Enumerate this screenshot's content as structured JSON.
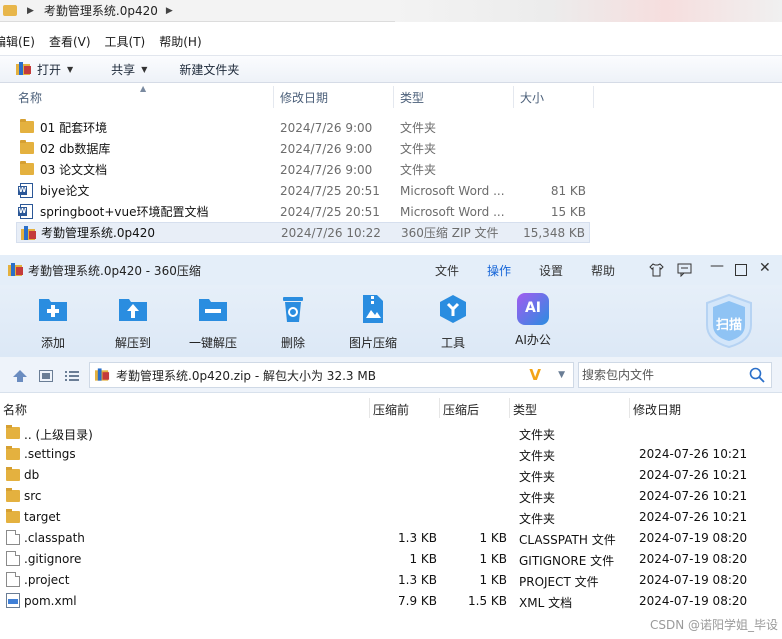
{
  "explorer": {
    "address_path": "考勤管理系统.0p420",
    "menu": [
      "编辑(E)",
      "查看(V)",
      "工具(T)",
      "帮助(H)"
    ],
    "toolbar": {
      "open": "打开",
      "share": "共享",
      "new_folder": "新建文件夹"
    },
    "columns": [
      "名称",
      "修改日期",
      "类型",
      "大小"
    ],
    "files": [
      {
        "name": "01 配套环境",
        "date": "2024/7/26 9:00",
        "type": "文件夹",
        "size": "",
        "icon": "folder-icon"
      },
      {
        "name": "02 db数据库",
        "date": "2024/7/26 9:00",
        "type": "文件夹",
        "size": "",
        "icon": "folder-icon"
      },
      {
        "name": "03 论文文档",
        "date": "2024/7/26 9:00",
        "type": "文件夹",
        "size": "",
        "icon": "folder-icon"
      },
      {
        "name": "biye论文",
        "date": "2024/7/25 20:51",
        "type": "Microsoft Word ...",
        "size": "81 KB",
        "icon": "word-doc-icon"
      },
      {
        "name": "springboot+vue环境配置文档",
        "date": "2024/7/25 20:51",
        "type": "Microsoft Word ...",
        "size": "15 KB",
        "icon": "word-doc-icon"
      },
      {
        "name": "考勤管理系统.0p420",
        "date": "2024/7/26 10:22",
        "type": "360压缩 ZIP 文件",
        "size": "15,348 KB",
        "icon": "zip-archive-icon"
      }
    ]
  },
  "zipapp": {
    "title": "考勤管理系统.0p420 - 360压缩",
    "menu": [
      "文件",
      "操作",
      "设置",
      "帮助"
    ],
    "active_menu": "操作",
    "tools": [
      "添加",
      "解压到",
      "一键解压",
      "删除",
      "图片压缩",
      "工具",
      "AI办公"
    ],
    "scan_label": "扫描",
    "ai_icon_text": "AI",
    "path_text": "考勤管理系统.0p420.zip - 解包大小为 32.3 MB",
    "search_placeholder": "搜索包内文件",
    "columns": [
      "名称",
      "压缩前",
      "压缩后",
      "类型",
      "修改日期"
    ],
    "rows": [
      {
        "name": ".. (上级目录)",
        "before": "",
        "after": "",
        "type": "文件夹",
        "date": "",
        "icon": "folder-icon"
      },
      {
        "name": ".settings",
        "before": "",
        "after": "",
        "type": "文件夹",
        "date": "2024-07-26 10:21",
        "icon": "folder-icon"
      },
      {
        "name": "db",
        "before": "",
        "after": "",
        "type": "文件夹",
        "date": "2024-07-26 10:21",
        "icon": "folder-icon"
      },
      {
        "name": "src",
        "before": "",
        "after": "",
        "type": "文件夹",
        "date": "2024-07-26 10:21",
        "icon": "folder-icon"
      },
      {
        "name": "target",
        "before": "",
        "after": "",
        "type": "文件夹",
        "date": "2024-07-26 10:21",
        "icon": "folder-icon"
      },
      {
        "name": ".classpath",
        "before": "1.3 KB",
        "after": "1 KB",
        "type": "CLASSPATH 文件",
        "date": "2024-07-19 08:20",
        "icon": "file-icon"
      },
      {
        "name": ".gitignore",
        "before": "1 KB",
        "after": "1 KB",
        "type": "GITIGNORE 文件",
        "date": "2024-07-19 08:20",
        "icon": "file-icon"
      },
      {
        "name": ".project",
        "before": "1.3 KB",
        "after": "1 KB",
        "type": "PROJECT 文件",
        "date": "2024-07-19 08:20",
        "icon": "file-icon"
      },
      {
        "name": "pom.xml",
        "before": "7.9 KB",
        "after": "1.5 KB",
        "type": "XML 文档",
        "date": "2024-07-19 08:20",
        "icon": "xml-file-icon"
      }
    ]
  },
  "watermark": "CSDN @诺阳学姐_毕设",
  "colors": {
    "accent": "#1565d8",
    "folder": "#e4b13f",
    "ribbon_icon": "#2a8de0"
  }
}
